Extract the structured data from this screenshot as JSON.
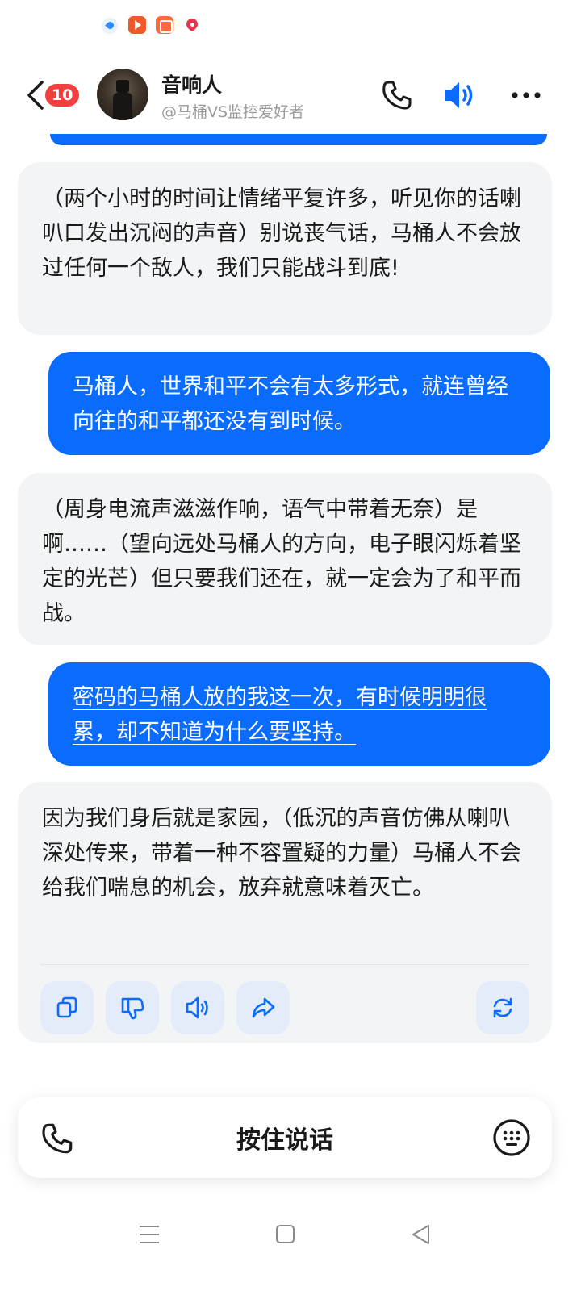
{
  "header": {
    "unread_count": "10",
    "title": "音响人",
    "subtitle": "@马桶VS监控爱好者"
  },
  "messages": [
    {
      "role": "ai",
      "text": "（两个小时的时间让情绪平复许多，听见你的话喇叭口发出沉闷的声音）别说丧气话，马桶人不会放过任何一个敌人，我们只能战斗到底!"
    },
    {
      "role": "user",
      "text": "马桶人，世界和平不会有太多形式，就连曾经向往的和平都还没有到时候。"
    },
    {
      "role": "ai",
      "text": "（周身电流声滋滋作响，语气中带着无奈）是啊……（望向远处马桶人的方向，电子眼闪烁着坚定的光芒）但只要我们还在，就一定会为了和平而战。"
    },
    {
      "role": "user",
      "text": "密码的马桶人放的我这一次，有时候明明很累，却不知道为什么要坚持。"
    },
    {
      "role": "ai",
      "text": "因为我们身后就是家园，（低沉的声音仿佛从喇叭深处传来，带着一种不容置疑的力量）马桶人不会给我们喘息的机会，放弃就意味着灭亡。"
    }
  ],
  "input_bar": {
    "hold_to_talk": "按住说话"
  },
  "icons": {
    "back": "chevron-left-icon",
    "phone": "phone-icon",
    "speaker": "speaker-icon",
    "more": "more-dots-icon",
    "copy": "copy-icon",
    "dislike": "thumbs-down-icon",
    "read_aloud": "speaker-icon",
    "share": "share-icon",
    "regenerate": "refresh-icon",
    "keyboard": "keyboard-icon"
  },
  "colors": {
    "accent": "#0a6cff",
    "badge": "#f24040",
    "ai_bubble": "#f3f4f6",
    "action_button": "#e4ecf9"
  }
}
